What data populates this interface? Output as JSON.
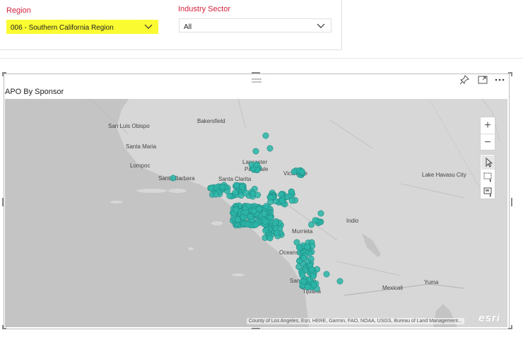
{
  "filters": {
    "region": {
      "label": "Region",
      "value": "006 - Southern California Region"
    },
    "industry": {
      "label": "Industry Sector",
      "value": "All"
    }
  },
  "visual": {
    "title": "APO By Sponsor",
    "header_icons": [
      "pin-icon",
      "focus-mode-icon",
      "more-options-icon"
    ]
  },
  "map": {
    "cities": [
      "Bakersfield",
      "San Luis Obispo",
      "Santa Maria",
      "Lompoc",
      "Lancaster",
      "Palmdale",
      "Santa Barbara",
      "Santa Clarita",
      "Victorville",
      "Lake Havasu City",
      "Indio",
      "Murrieta",
      "Oceanside",
      "San Diego",
      "Tijuana",
      "Mexicali",
      "Yuma"
    ],
    "controls": {
      "zoom_in": "+",
      "zoom_out": "−"
    },
    "attribution": "County of Los Angeles, Esri, HERE, Garmin, FAO, NOAA, USGS, Bureau of Land Management...",
    "logo": "esri",
    "marker_color": "#2bb5a8"
  },
  "colors": {
    "slicer_label": "#d4213d",
    "highlight": "#fbfb32",
    "land": "#d7d7d7",
    "water": "#c4c4c4"
  }
}
